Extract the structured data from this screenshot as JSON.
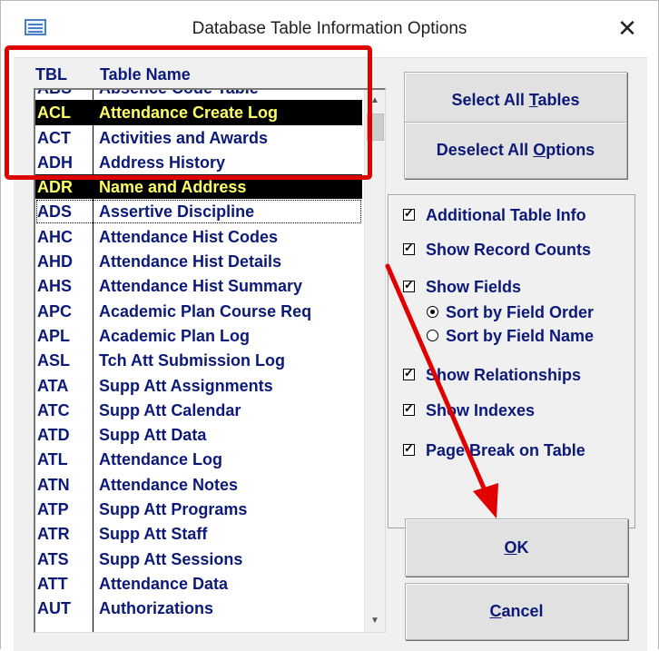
{
  "window": {
    "title": "Database Table Information Options",
    "close_glyph": "✕"
  },
  "list": {
    "header_tbl": "TBL",
    "header_name": "Table Name",
    "rows": [
      {
        "code": "ABS",
        "name": "Absence Code Table"
      },
      {
        "code": "ACL",
        "name": "Attendance Create Log"
      },
      {
        "code": "ACT",
        "name": "Activities and Awards"
      },
      {
        "code": "ADH",
        "name": "Address History"
      },
      {
        "code": "ADR",
        "name": "Name and Address"
      },
      {
        "code": "ADS",
        "name": "Assertive Discipline"
      },
      {
        "code": "AHC",
        "name": "Attendance Hist Codes"
      },
      {
        "code": "AHD",
        "name": "Attendance Hist Details"
      },
      {
        "code": "AHS",
        "name": "Attendance Hist Summary"
      },
      {
        "code": "APC",
        "name": "Academic Plan Course Req"
      },
      {
        "code": "APL",
        "name": "Academic Plan Log"
      },
      {
        "code": "ASL",
        "name": "Tch Att Submission Log"
      },
      {
        "code": "ATA",
        "name": "Supp Att Assignments"
      },
      {
        "code": "ATC",
        "name": "Supp Att Calendar"
      },
      {
        "code": "ATD",
        "name": "Supp Att Data"
      },
      {
        "code": "ATL",
        "name": "Attendance Log"
      },
      {
        "code": "ATN",
        "name": "Attendance Notes"
      },
      {
        "code": "ATP",
        "name": "Supp Att Programs"
      },
      {
        "code": "ATR",
        "name": "Supp Att Staff"
      },
      {
        "code": "ATS",
        "name": "Supp Att Sessions"
      },
      {
        "code": "ATT",
        "name": "Attendance Data"
      },
      {
        "code": "AUT",
        "name": "Authorizations"
      }
    ]
  },
  "buttons": {
    "select_all_pre": "Select All ",
    "select_all_key": "T",
    "select_all_post": "ables",
    "deselect_pre": "Deselect All ",
    "deselect_key": "O",
    "deselect_post": "ptions",
    "ok_key": "O",
    "ok_post": "K",
    "cancel_key": "C",
    "cancel_post": "ancel"
  },
  "options": {
    "additional_info": "Additional Table Info",
    "show_record_counts": "Show Record Counts",
    "show_fields": "Show Fields",
    "sort_by_field_order": "Sort by Field Order",
    "sort_by_field_name": "Sort by Field Name",
    "show_relationships": "Show Relationships",
    "show_indexes": "Show Indexes",
    "page_break": "Page Break on Table"
  },
  "colors": {
    "highlight": "#e00000",
    "label": "#0b1a78",
    "selected_text": "#ffff66"
  }
}
